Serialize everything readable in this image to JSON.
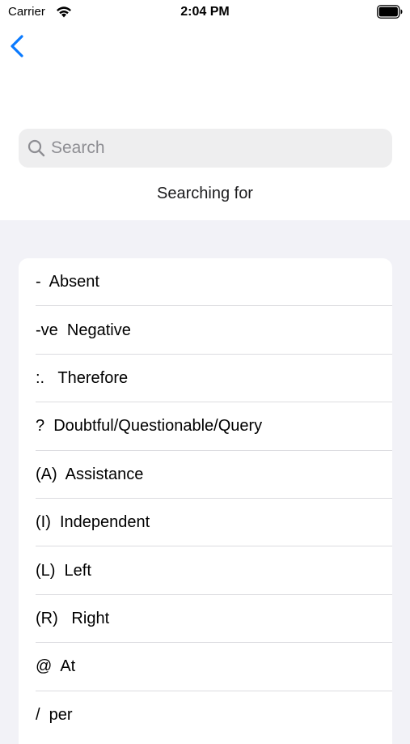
{
  "status_bar": {
    "carrier": "Carrier",
    "time": "2:04 PM"
  },
  "nav": {
    "back_icon": "chevron-left-icon"
  },
  "search": {
    "placeholder": "Search",
    "value": ""
  },
  "searching_for_label": "Searching for",
  "abbreviations": [
    {
      "text": "-  Absent"
    },
    {
      "text": "-ve  Negative"
    },
    {
      "text": ":.   Therefore"
    },
    {
      "text": "?  Doubtful/Questionable/Query"
    },
    {
      "text": "(A)  Assistance"
    },
    {
      "text": "(I)  Independent"
    },
    {
      "text": "(L)  Left"
    },
    {
      "text": "(R)   Right"
    },
    {
      "text": "@  At"
    },
    {
      "text": "/  per"
    }
  ],
  "colors": {
    "accent": "#0a7aff",
    "background": "#f2f2f7",
    "card": "#ffffff",
    "search_fill": "#eeeeef",
    "placeholder": "#8e8e93"
  }
}
